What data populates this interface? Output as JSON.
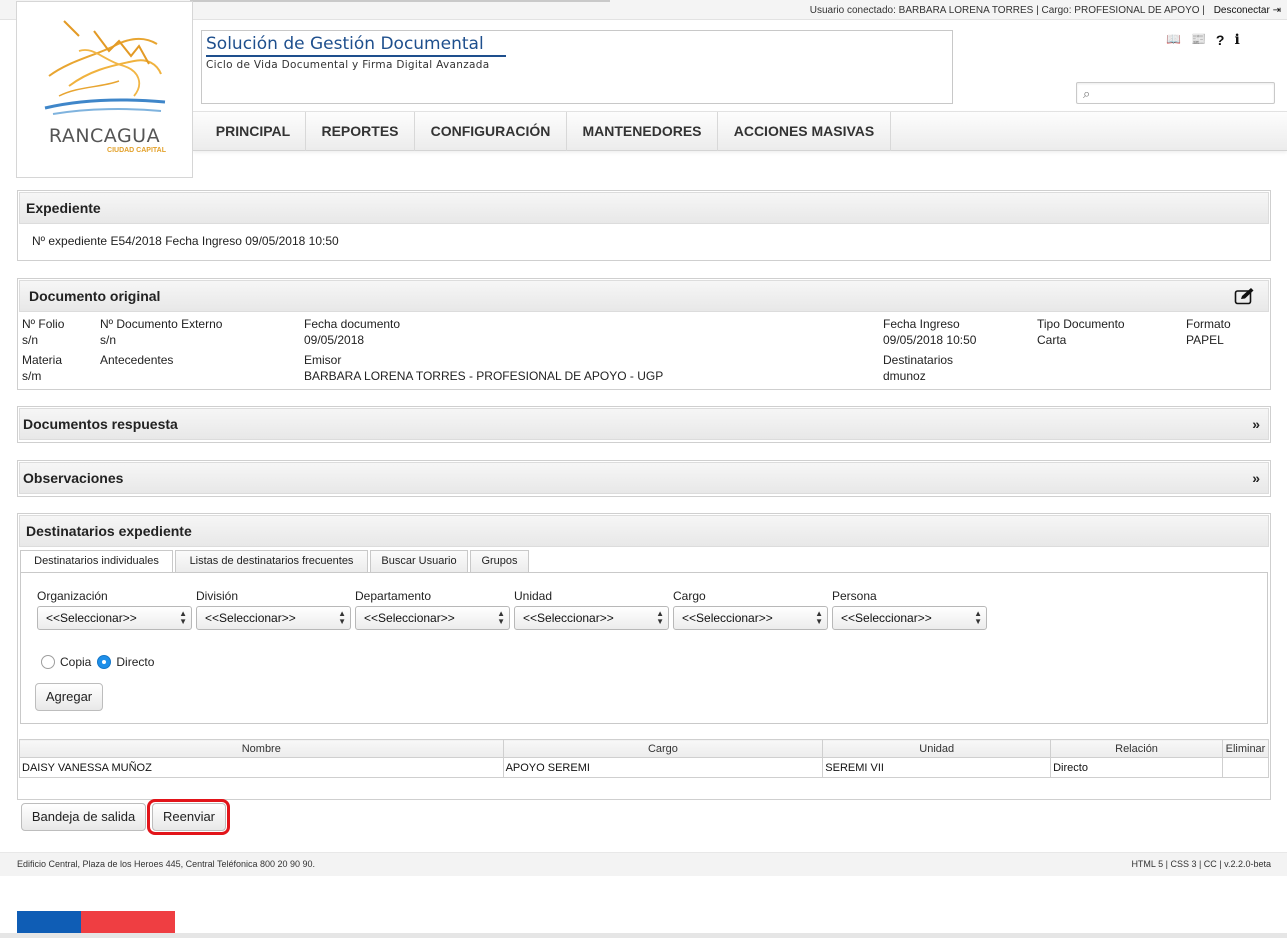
{
  "userbar": {
    "text": "Usuario conectado: BARBARA LORENA TORRES | Cargo: PROFESIONAL DE APOYO |",
    "logout": "Desconectar"
  },
  "logo": {
    "name": "RANCAGUA",
    "sub": "CIUDAD CAPITAL"
  },
  "header": {
    "title": "Solución de Gestión Documental",
    "subtitle": "Ciclo de Vida Documental y Firma Digital Avanzada"
  },
  "toolicons": {
    "book": "📖",
    "news": "📰",
    "help": "?",
    "info": "i"
  },
  "search": {
    "value": "",
    "placeholder": ""
  },
  "nav": [
    "PRINCIPAL",
    "REPORTES",
    "CONFIGURACIÓN",
    "MANTENEDORES",
    "ACCIONES MASIVAS"
  ],
  "expediente": {
    "title": "Expediente",
    "label_num": "Nº expediente",
    "num": "E54/2018",
    "label_fecha": "Fecha Ingreso",
    "fecha": "09/05/2018 10:50"
  },
  "documento": {
    "title": "Documento original",
    "fields": {
      "folio_l": "Nº Folio",
      "folio_v": "s/n",
      "ext_l": "Nº Documento Externo",
      "ext_v": "s/n",
      "fecha_l": "Fecha documento",
      "fecha_v": "09/05/2018",
      "ingreso_l": "Fecha Ingreso",
      "ingreso_v": "09/05/2018 10:50",
      "tipo_l": "Tipo Documento",
      "tipo_v": "Carta",
      "formato_l": "Formato",
      "formato_v": "PAPEL",
      "materia_l": "Materia",
      "materia_v": "s/m",
      "antecedentes_l": "Antecedentes",
      "emisor_l": "Emisor",
      "emisor_v": "BARBARA LORENA TORRES - PROFESIONAL DE APOYO - UGP",
      "dest_l": "Destinatarios",
      "dest_v": "dmunoz"
    }
  },
  "respuesta": {
    "title": "Documentos respuesta",
    "expand": "»"
  },
  "observaciones": {
    "title": "Observaciones",
    "expand": "»"
  },
  "destinatarios": {
    "title": "Destinatarios expediente",
    "tabs": [
      "Destinatarios individuales",
      "Listas de destinatarios frecuentes",
      "Buscar Usuario",
      "Grupos"
    ],
    "fields": [
      {
        "label": "Organización",
        "value": "<<Seleccionar>>"
      },
      {
        "label": "División",
        "value": "<<Seleccionar>>"
      },
      {
        "label": "Departamento",
        "value": "<<Seleccionar>>"
      },
      {
        "label": "Unidad",
        "value": "<<Seleccionar>>"
      },
      {
        "label": "Cargo",
        "value": "<<Seleccionar>>"
      },
      {
        "label": "Persona",
        "value": "<<Seleccionar>>"
      }
    ],
    "radio_copia": "Copia",
    "radio_directo": "Directo",
    "add_button": "Agregar",
    "table": {
      "headers": [
        "Nombre",
        "Cargo",
        "Unidad",
        "Relación",
        "Eliminar"
      ],
      "rows": [
        [
          "DAISY VANESSA MUÑOZ",
          "APOYO SEREMI",
          "SEREMI VII",
          "Directo",
          ""
        ]
      ]
    }
  },
  "actions": {
    "outbox": "Bandeja de salida",
    "resend": "Reenviar"
  },
  "footer": {
    "address": "Edificio Central, Plaza de los Heroes 445, Central Teléfonica 800 20 90 90.",
    "tech": "HTML 5 | CSS 3 | CC | v.2.2.0-beta"
  },
  "colors": {
    "brand_blue": "#1e4f8d",
    "highlight_red": "#e2141a",
    "flag_blue": "#0f5db5",
    "flag_red": "#ef3e42"
  }
}
